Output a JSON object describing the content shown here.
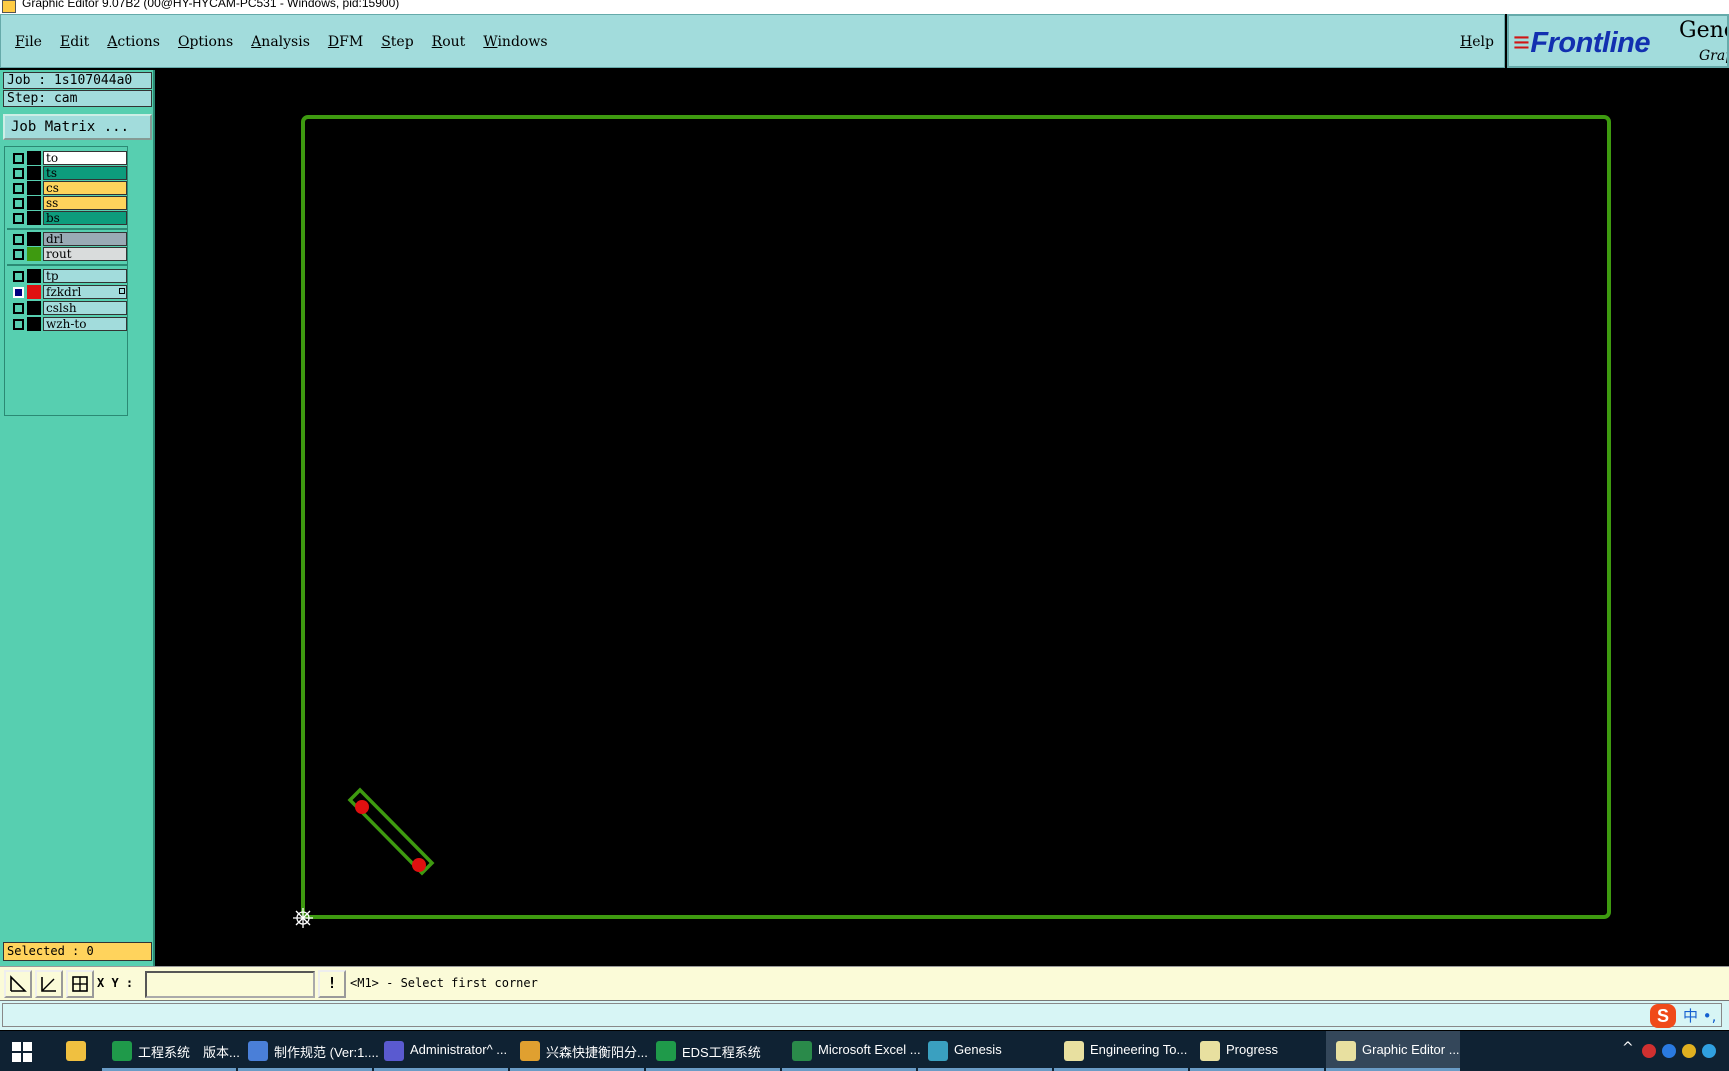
{
  "window": {
    "title": "Graphic Editor 9.07B2 (00@HY-HYCAM-PC531 - Windows, pid:15900)"
  },
  "menu": {
    "items": [
      "File",
      "Edit",
      "Actions",
      "Options",
      "Analysis",
      "DFM",
      "Step",
      "Rout",
      "Windows"
    ],
    "help": "Help"
  },
  "brand": {
    "logo": "Frontline",
    "gene": "Gene",
    "grap": "Grap"
  },
  "panel": {
    "job": "Job : 1s107044a0",
    "step": "Step: cam",
    "job_matrix": "Job Matrix ...",
    "selected": "Selected : 0"
  },
  "layers": [
    {
      "name": "to",
      "color": "#ffffff",
      "swatch": "#000000",
      "checked": false
    },
    {
      "name": "ts",
      "color": "#0d9c7c",
      "swatch": "#000000",
      "checked": false
    },
    {
      "name": "cs",
      "color": "#ffd35c",
      "swatch": "#000000",
      "checked": false
    },
    {
      "name": "ss",
      "color": "#ffd35c",
      "swatch": "#000000",
      "checked": false
    },
    {
      "name": "bs",
      "color": "#0d9c7c",
      "swatch": "#000000",
      "checked": false
    },
    {
      "name": "drl",
      "color": "#9aaab5",
      "swatch": "#000000",
      "checked": false
    },
    {
      "name": "rout",
      "color": "#d9dcdc",
      "swatch": "#3e9a10",
      "checked": false
    },
    {
      "name": "tp",
      "color": "#a2dcdc",
      "swatch": "#000000",
      "checked": false
    },
    {
      "name": "fzkdrl",
      "color": "#a2dcdc",
      "swatch": "#e01010",
      "checked": true
    },
    {
      "name": "cslsh",
      "color": "#a2dcdc",
      "swatch": "#000000",
      "checked": false
    },
    {
      "name": "wzh-to",
      "color": "#a2dcdc",
      "swatch": "#000000",
      "checked": false
    }
  ],
  "drawing": {
    "outline_color": "#3e9a10",
    "pad_color": "#e01010",
    "cursor_color": "#ffffff"
  },
  "bottom": {
    "xy_label": "X Y :",
    "xy_value": "",
    "warn_icon": "!",
    "prompt": "<M1> - Select first corner"
  },
  "status": {
    "sogou_icon": "S",
    "ime": "中 •,"
  },
  "taskbar": {
    "items": [
      {
        "label": "工程系统　版本...",
        "icon": "#1f9a4a"
      },
      {
        "label": "制作规范 (Ver:1....",
        "icon": "#4a7fd8"
      },
      {
        "label": "Administrator^ ...",
        "icon": "#5a5ad0"
      },
      {
        "label": "兴森快捷衡阳分...",
        "icon": "#e0a030"
      },
      {
        "label": "EDS工程系统",
        "icon": "#1f9a4a"
      },
      {
        "label": "Microsoft Excel ...",
        "icon": "#2a8a4a"
      },
      {
        "label": "Genesis",
        "icon": "#3aa0c0"
      },
      {
        "label": "Engineering To...",
        "icon": "#e8e0a0"
      },
      {
        "label": "Progress",
        "icon": "#e8e0a0"
      },
      {
        "label": "Graphic Editor ...",
        "icon": "#e8e0a0"
      }
    ]
  }
}
